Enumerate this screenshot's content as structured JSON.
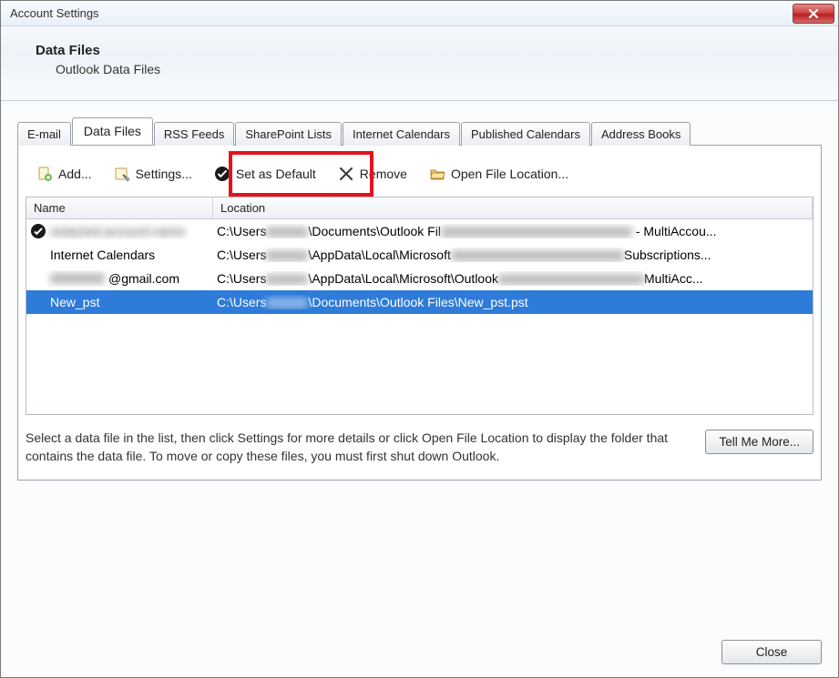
{
  "window": {
    "title": "Account Settings"
  },
  "header": {
    "title": "Data Files",
    "subtitle": "Outlook Data Files"
  },
  "tabs": [
    {
      "label": "E-mail"
    },
    {
      "label": "Data Files"
    },
    {
      "label": "RSS Feeds"
    },
    {
      "label": "SharePoint Lists"
    },
    {
      "label": "Internet Calendars"
    },
    {
      "label": "Published Calendars"
    },
    {
      "label": "Address Books"
    }
  ],
  "toolbar": {
    "add": "Add...",
    "settings": "Settings...",
    "set_default": "Set as Default",
    "remove": "Remove",
    "open_location": "Open File Location..."
  },
  "columns": {
    "name": "Name",
    "location": "Location"
  },
  "rows": [
    {
      "is_default": true,
      "name_prefix": "",
      "name_blur": "redacted-account-name",
      "name_suffix": "",
      "loc_prefix": "C:\\Users",
      "loc_mid": "\\Documents\\Outlook Fil",
      "loc_suffix": " - MultiAccou..."
    },
    {
      "is_default": false,
      "name_prefix": "Internet Calendars",
      "name_blur": "",
      "name_suffix": "",
      "loc_prefix": "C:\\Users",
      "loc_mid": "\\AppData\\Local\\Microsoft",
      "loc_suffix": "Subscriptions..."
    },
    {
      "is_default": false,
      "name_prefix": "",
      "name_blur": "user",
      "name_suffix": "@gmail.com",
      "loc_prefix": "C:\\Users",
      "loc_mid": "\\AppData\\Local\\Microsoft\\Outlook",
      "loc_suffix": "MultiAcc..."
    },
    {
      "is_default": false,
      "selected": true,
      "name_prefix": "New_pst",
      "name_blur": "",
      "name_suffix": "",
      "loc_prefix": "C:\\Users",
      "loc_mid": "\\Documents\\Outlook Files\\New_pst.pst",
      "loc_suffix": ""
    }
  ],
  "help_text": "Select a data file in the list, then click Settings for more details or click Open File Location to display the folder that contains the data file. To move or copy these files, you must first shut down Outlook.",
  "buttons": {
    "tell_me_more": "Tell Me More...",
    "close": "Close"
  }
}
